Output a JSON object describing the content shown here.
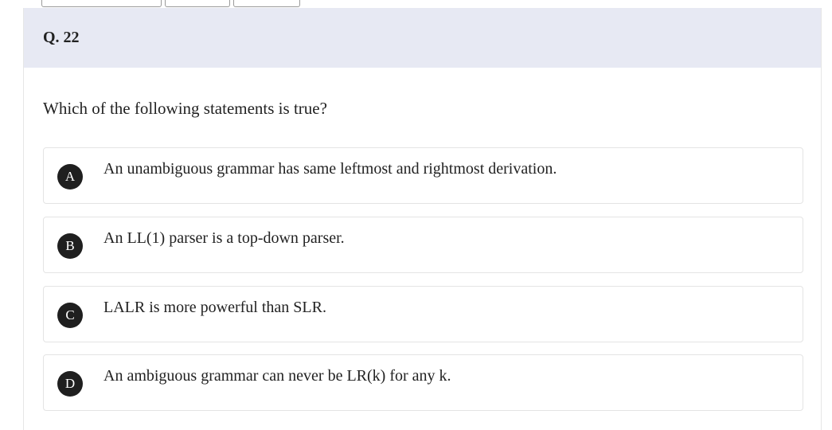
{
  "question": {
    "number": "Q. 22",
    "text": "Which of the following statements is true?"
  },
  "options": [
    {
      "letter": "A",
      "text": "An unambiguous grammar has same leftmost and rightmost derivation."
    },
    {
      "letter": "B",
      "text": "An LL(1) parser is a top-down parser."
    },
    {
      "letter": "C",
      "text": "LALR is more powerful than SLR."
    },
    {
      "letter": "D",
      "text": "An ambiguous grammar can never be LR(k) for any k."
    }
  ],
  "colors": {
    "header_bg": "#e7e9f3",
    "letter_badge_bg": "#1f1f1f",
    "option_border": "#e4e4e4"
  }
}
